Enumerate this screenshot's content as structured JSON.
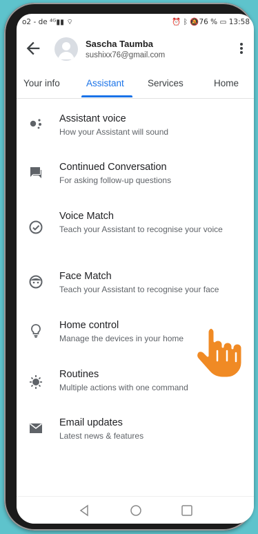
{
  "status_bar": {
    "carrier": "o2 - de",
    "indicators": "76 %",
    "time": "13:58"
  },
  "account": {
    "name": "Sascha Taumba",
    "email": "sushixx76@gmail.com"
  },
  "tabs": [
    {
      "label": "Your info"
    },
    {
      "label": "Assistant",
      "active": true
    },
    {
      "label": "Services"
    },
    {
      "label": "Home"
    }
  ],
  "settings": [
    {
      "title": "Assistant voice",
      "subtitle": "How your Assistant will sound",
      "icon": "assistant-dots-icon"
    },
    {
      "title": "Continued Conversation",
      "subtitle": "For asking follow-up questions",
      "icon": "chat-bubble-icon"
    },
    {
      "title": "Voice Match",
      "subtitle": "Teach your Assistant to recognise your voice",
      "icon": "check-circle-icon"
    },
    {
      "title": "Face Match",
      "subtitle": "Teach your Assistant to recognise your face",
      "icon": "face-icon"
    },
    {
      "title": "Home control",
      "subtitle": "Manage the devices in your home",
      "icon": "lightbulb-icon"
    },
    {
      "title": "Routines",
      "subtitle": "Multiple actions with one command",
      "icon": "sun-routine-icon"
    },
    {
      "title": "Email updates",
      "subtitle": "Latest news & features",
      "icon": "mail-icon"
    }
  ],
  "colors": {
    "accent": "#1a73e8",
    "background": "#5ec3cc",
    "pointer": "#f08a24"
  }
}
